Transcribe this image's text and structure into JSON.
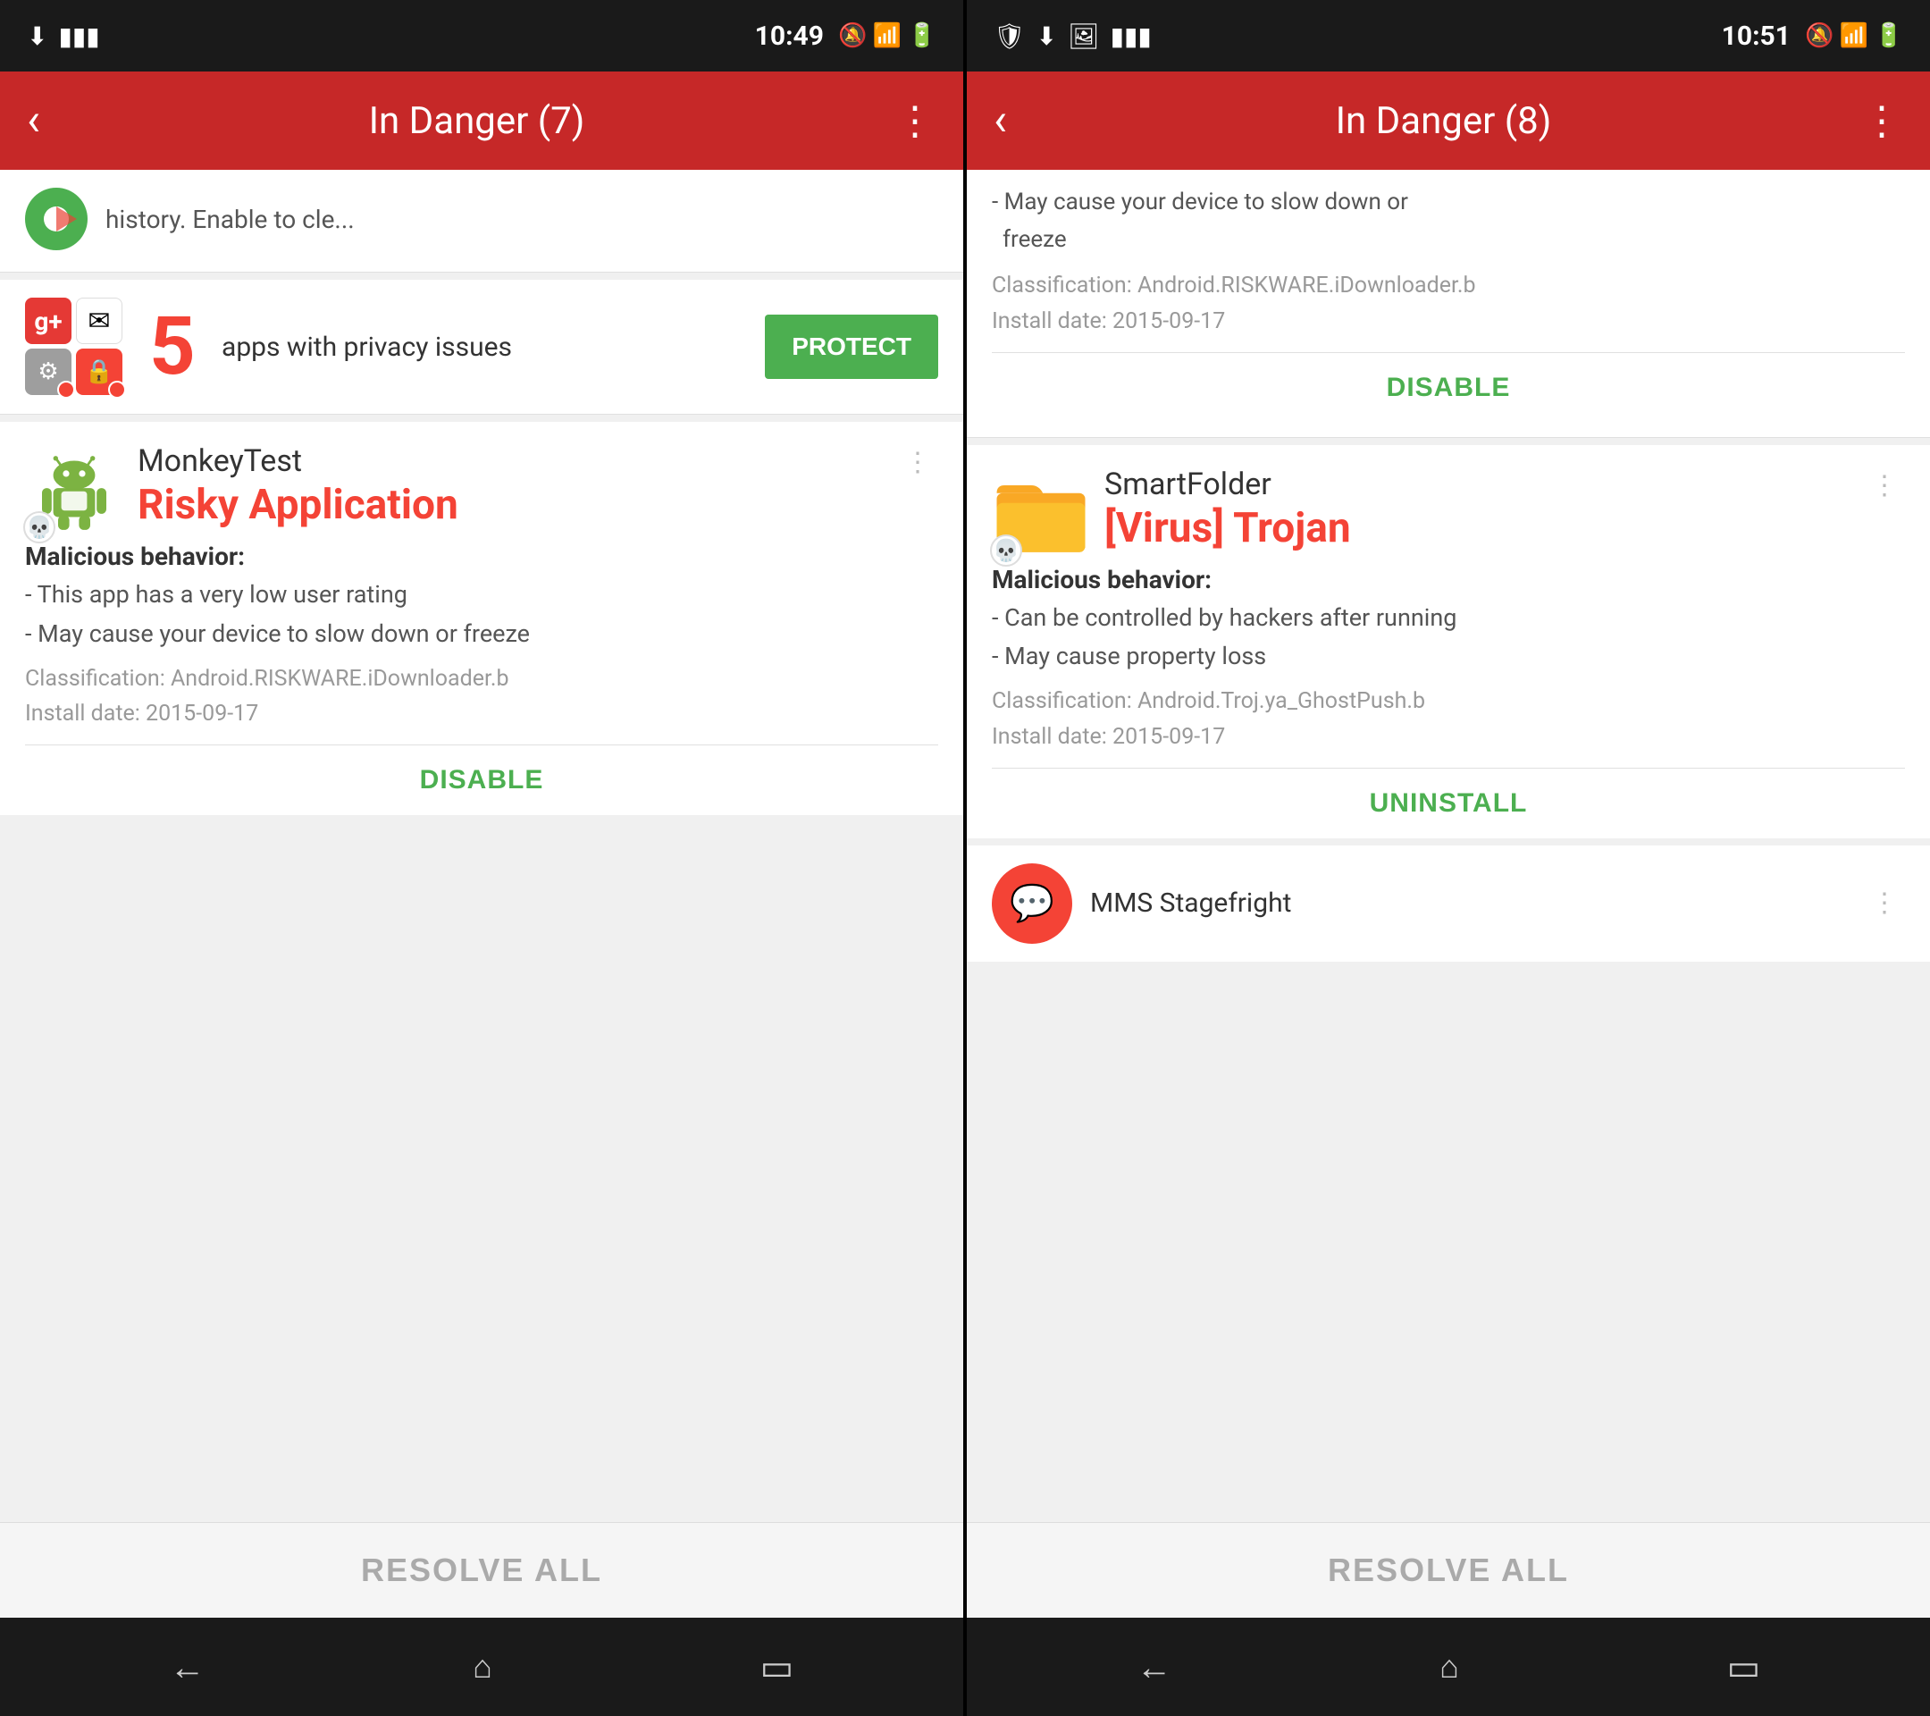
{
  "panels": [
    {
      "id": "left",
      "status_bar": {
        "time": "10:49",
        "left_icons": "🔔 ≡",
        "right_icons": "🔕 📶 🔋"
      },
      "header": {
        "title": "In Danger (7)",
        "back_label": "‹",
        "menu_label": "⋮"
      },
      "top_card": {
        "text": "history. Enable to cle..."
      },
      "privacy_card": {
        "count": "5",
        "text": "apps with privacy issues",
        "protect_label": "PROTECT"
      },
      "threat_card": {
        "app_name": "MonkeyTest",
        "threat_label": "Risky Application",
        "malicious_title": "Malicious behavior:",
        "items": [
          "- This app has a very low user rating",
          "- May cause your device to slow down or freeze"
        ],
        "classification": "Classification: Android.RISKWARE.iDownloader.b",
        "install_date": "Install date: 2015-09-17",
        "action_label": "DISABLE"
      },
      "resolve_all_label": "RESOLVE ALL"
    },
    {
      "id": "right",
      "status_bar": {
        "time": "10:51",
        "left_icons": "🔕 📶 🔋",
        "right_icons": ""
      },
      "header": {
        "title": "In Danger (8)",
        "back_label": "‹",
        "menu_label": "⋮"
      },
      "top_card": {
        "classification": "Classification: Android.RISKWARE.iDownloader.b",
        "install_date": "Install date: 2015-09-17",
        "action_label": "DISABLE",
        "desc_items": [
          "- May cause your device to slow down or",
          "  freeze"
        ]
      },
      "threat_card": {
        "app_name": "SmartFolder",
        "threat_label": "[Virus] Trojan",
        "malicious_title": "Malicious behavior:",
        "items": [
          "- Can be controlled by hackers after running",
          "- May cause property loss"
        ],
        "classification": "Classification: Android.Troj.ya_GhostPush.b",
        "install_date": "Install date: 2015-09-17",
        "action_label": "UNINSTALL"
      },
      "bottom_card": {
        "text": "MMS Stagefright"
      },
      "resolve_all_label": "RESOLVE ALL"
    }
  ],
  "bottom_nav": {
    "back_icon": "←",
    "home_icon": "⌂",
    "recent_icon": "▭"
  }
}
